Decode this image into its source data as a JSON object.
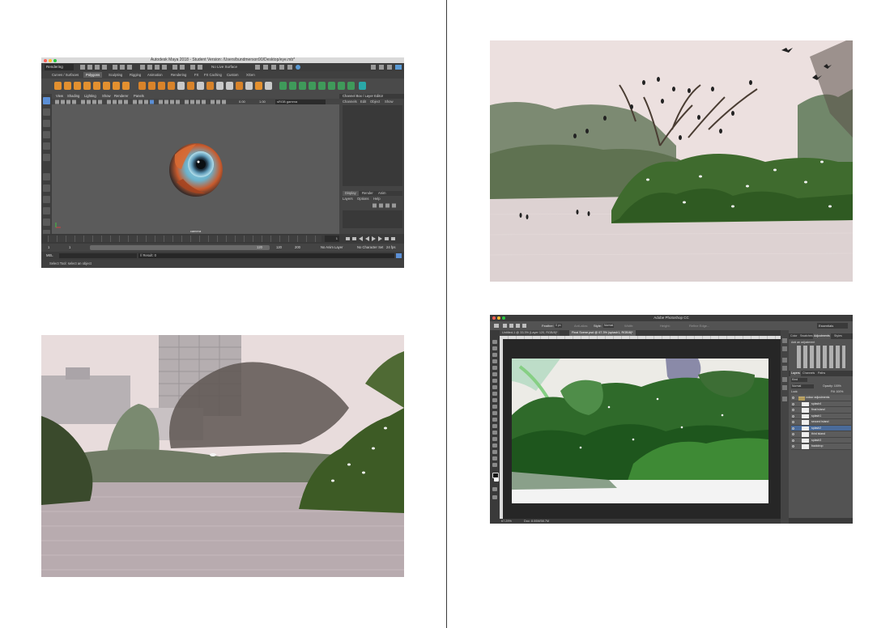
{
  "maya": {
    "window_title": "Autodesk Maya 2018 - Student Version: /Users/bundmerson90/Desktop/eye.mb*",
    "mode_menu": "Rendering",
    "live_surface": "No Live Surface",
    "shelf_tabs": [
      "Curves / Surfaces",
      "Polygons",
      "Sculpting",
      "Rigging",
      "Animation",
      "Rendering",
      "FX",
      "FX Caching",
      "Custom",
      "XGen"
    ],
    "active_shelf": "Polygons",
    "panel_menus": [
      "View",
      "Shading",
      "Lighting",
      "Show",
      "Renderer",
      "Panels"
    ],
    "gamma_menu": "sRGB gamma",
    "gamma_values": [
      "0.00",
      "1.00"
    ],
    "viewport_camera_label": "camera",
    "channel_box_title": "Channel Box / Layer Editor",
    "channel_box_menus": [
      "Channels",
      "Edit",
      "Object",
      "Show"
    ],
    "layer_tabs": [
      "Display",
      "Render",
      "Anim"
    ],
    "layer_menus": [
      "Layers",
      "Options",
      "Help"
    ],
    "current_frame": "1",
    "range_start": "1",
    "range_inner_start": "1",
    "range_end": "120",
    "anim_end_1": "120",
    "anim_end_2": "200",
    "anim_layer": "No Anim Layer",
    "character_set": "No Character Set",
    "fps": "24 fps",
    "command_language": "MEL",
    "command_result": "// Result: 0",
    "help_line": "Select Tool: select an object"
  },
  "photoshop": {
    "window_title": "Adobe Photoshop CC",
    "options": {
      "feather_label": "Feather:",
      "feather_value": "0 px",
      "antialias": "Anti-alias",
      "style_label": "Style:",
      "style_value": "Normal",
      "width_label": "Width:",
      "height_label": "Height:",
      "refine": "Refine Edge..."
    },
    "workspace": "Essentials",
    "doc_tabs": [
      "Untitled-1 @ 33.3% (Layer 120, RGB/8)*",
      "Final Scene.psd @ 67.3% (splash1, RGB/8)*"
    ],
    "active_doc_tab": 1,
    "status_zoom": "67.29%",
    "status_doc": "Doc: 8.00M/58.7M",
    "panel_tabs": [
      "Color",
      "Swatches",
      "Adjustments",
      "Styles"
    ],
    "active_panel_tab": "Adjustments",
    "add_adjustment_label": "Add an adjustment",
    "layer_panel_tabs": [
      "Layers",
      "Channels",
      "Paths"
    ],
    "kind_filter": "Kind",
    "blend_mode": "Normal",
    "opacity_label": "Opacity:",
    "opacity": "100%",
    "lock_label": "Lock:",
    "fill_label": "Fill:",
    "fill": "100%",
    "layers": [
      {
        "name": "colour adjustments",
        "group": true,
        "selected": false
      },
      {
        "name": "splash4",
        "group": false,
        "selected": false
      },
      {
        "name": "final island",
        "group": false,
        "selected": false
      },
      {
        "name": "splash1",
        "group": false,
        "selected": false
      },
      {
        "name": "second island",
        "group": false,
        "selected": false
      },
      {
        "name": "splash2",
        "group": false,
        "selected": true
      },
      {
        "name": "third island",
        "group": false,
        "selected": false
      },
      {
        "name": "splash3",
        "group": false,
        "selected": false
      },
      {
        "name": "backdrop",
        "group": false,
        "selected": false
      }
    ]
  }
}
